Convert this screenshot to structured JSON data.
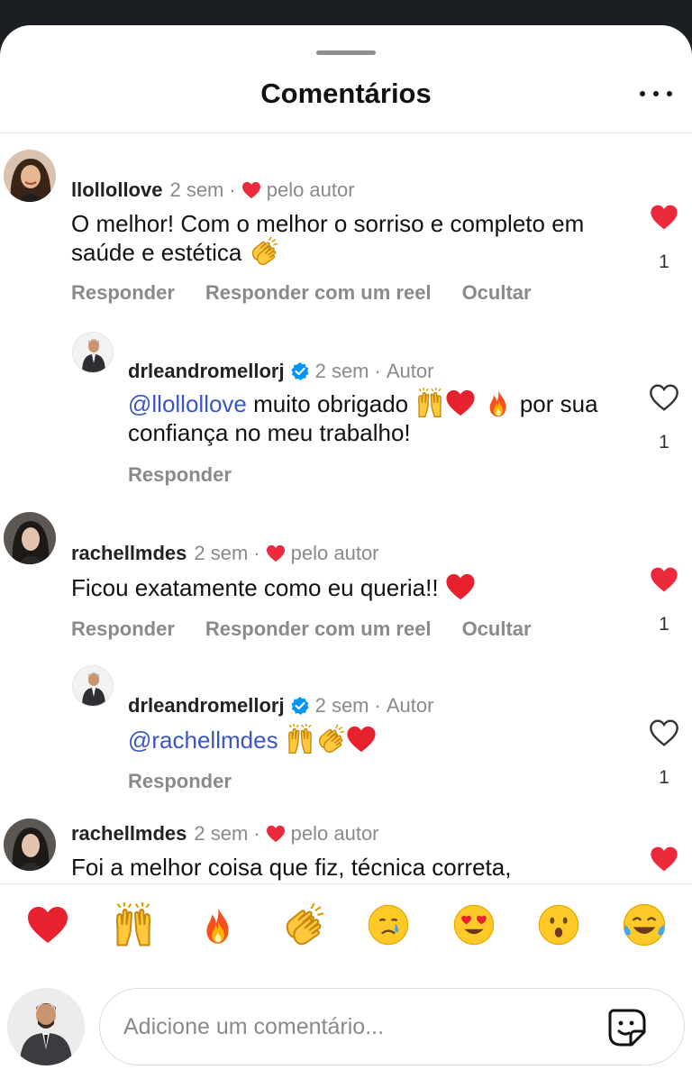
{
  "sheet": {
    "title": "Comentários"
  },
  "comments": [
    {
      "user": "llollollove",
      "time": "2 sem",
      "author_like": "pelo autor",
      "text": "O melhor! Com o melhor o sorriso e completo em saúde e estética",
      "emoji": [
        "clapping-hands"
      ],
      "actions": [
        "Responder",
        "Responder com um reel",
        "Ocultar"
      ],
      "liked": true,
      "like_count": "1"
    },
    {
      "user": "drleandromellorj",
      "time": "2 sem",
      "badge": "Autor",
      "mention": "@llollollove",
      "text_a": "muito obrigado",
      "text_b": "por",
      "text_c": "sua confiança no meu trabalho!",
      "emoji": [
        "raising-hands",
        "red-heart",
        "fire"
      ],
      "actions": [
        "Responder"
      ],
      "liked": false,
      "like_count": "1"
    },
    {
      "user": "rachellmdes",
      "time": "2 sem",
      "author_like": "pelo autor",
      "text": "Ficou exatamente como eu queria!!",
      "emoji": [
        "red-heart"
      ],
      "actions": [
        "Responder",
        "Responder com um reel",
        "Ocultar"
      ],
      "liked": true,
      "like_count": "1"
    },
    {
      "user": "drleandromellorj",
      "time": "2 sem",
      "badge": "Autor",
      "mention": "@rachellmdes",
      "emoji": [
        "raising-hands",
        "clapping-hands",
        "red-heart"
      ],
      "actions": [
        "Responder"
      ],
      "liked": false,
      "like_count": "1"
    },
    {
      "user": "rachellmdes",
      "time": "2 sem",
      "author_like": "pelo autor",
      "text": "Foi a melhor coisa que fiz, técnica correta,",
      "liked": true
    }
  ],
  "emoji_bar": [
    "red-heart",
    "raising-hands",
    "fire",
    "clapping-hands",
    "crying-face",
    "heart-eyes",
    "surprised-face",
    "tears-of-joy"
  ],
  "composer": {
    "placeholder": "Adicione um comentário..."
  },
  "colors": {
    "like_red": "#ed2a3c",
    "mention_blue": "#3a56c5",
    "verified_blue": "#0095f6",
    "muted": "#8a8a8a"
  }
}
